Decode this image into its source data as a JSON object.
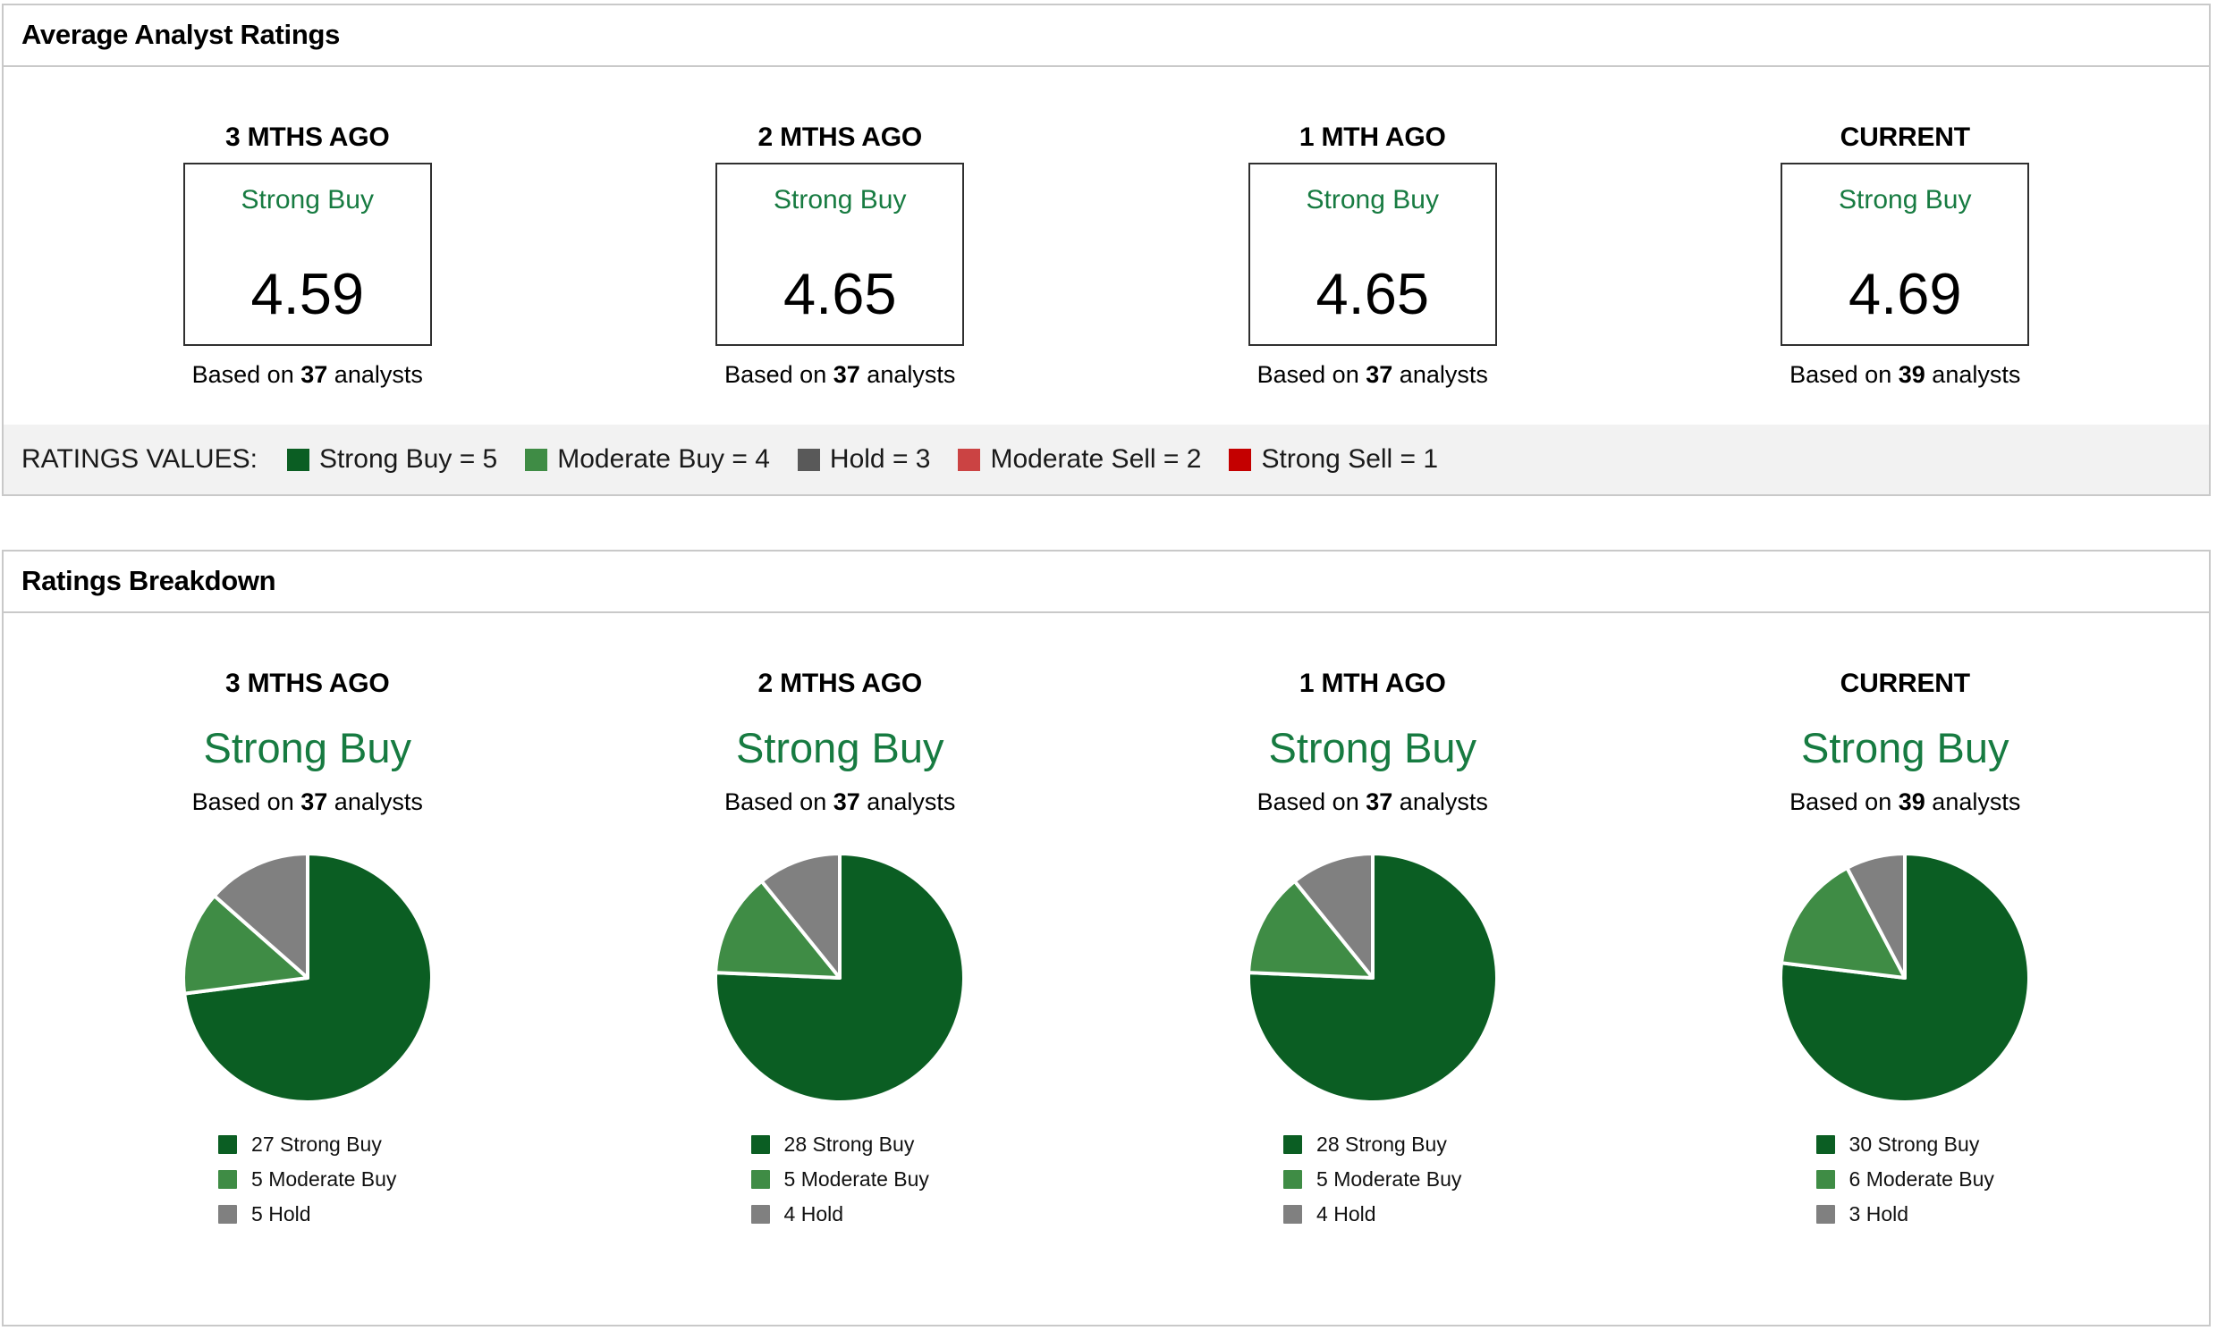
{
  "panel1": {
    "title": "Average Analyst Ratings",
    "columns": [
      {
        "period": "3 MTHS AGO",
        "rating": "Strong Buy",
        "score": "4.59",
        "based_prefix": "Based on",
        "analysts": "37",
        "based_suffix": "analysts"
      },
      {
        "period": "2 MTHS AGO",
        "rating": "Strong Buy",
        "score": "4.65",
        "based_prefix": "Based on",
        "analysts": "37",
        "based_suffix": "analysts"
      },
      {
        "period": "1 MTH AGO",
        "rating": "Strong Buy",
        "score": "4.65",
        "based_prefix": "Based on",
        "analysts": "37",
        "based_suffix": "analysts"
      },
      {
        "period": "CURRENT",
        "rating": "Strong Buy",
        "score": "4.69",
        "based_prefix": "Based on",
        "analysts": "39",
        "based_suffix": "analysts"
      }
    ],
    "legend": {
      "label": "RATINGS VALUES:",
      "items": [
        {
          "label": "Strong Buy = 5",
          "color": "#0b5e23"
        },
        {
          "label": "Moderate Buy = 4",
          "color": "#3f8c45"
        },
        {
          "label": "Hold = 3",
          "color": "#595959"
        },
        {
          "label": "Moderate Sell = 2",
          "color": "#cb4343"
        },
        {
          "label": "Strong Sell = 1",
          "color": "#c40000"
        }
      ]
    }
  },
  "panel2": {
    "title": "Ratings Breakdown",
    "columns": [
      {
        "period": "3 MTHS AGO",
        "rating": "Strong Buy",
        "based_prefix": "Based on",
        "analysts": "37",
        "based_suffix": "analysts",
        "legend": [
          {
            "count": "27",
            "label": "Strong Buy"
          },
          {
            "count": "5",
            "label": "Moderate Buy"
          },
          {
            "count": "5",
            "label": "Hold"
          }
        ]
      },
      {
        "period": "2 MTHS AGO",
        "rating": "Strong Buy",
        "based_prefix": "Based on",
        "analysts": "37",
        "based_suffix": "analysts",
        "legend": [
          {
            "count": "28",
            "label": "Strong Buy"
          },
          {
            "count": "5",
            "label": "Moderate Buy"
          },
          {
            "count": "4",
            "label": "Hold"
          }
        ]
      },
      {
        "period": "1 MTH AGO",
        "rating": "Strong Buy",
        "based_prefix": "Based on",
        "analysts": "37",
        "based_suffix": "analysts",
        "legend": [
          {
            "count": "28",
            "label": "Strong Buy"
          },
          {
            "count": "5",
            "label": "Moderate Buy"
          },
          {
            "count": "4",
            "label": "Hold"
          }
        ]
      },
      {
        "period": "CURRENT",
        "rating": "Strong Buy",
        "based_prefix": "Based on",
        "analysts": "39",
        "based_suffix": "analysts",
        "legend": [
          {
            "count": "30",
            "label": "Strong Buy"
          },
          {
            "count": "6",
            "label": "Moderate Buy"
          },
          {
            "count": "3",
            "label": "Hold"
          }
        ]
      }
    ]
  },
  "chart_data": [
    {
      "type": "pie",
      "title": "3 MTHS AGO",
      "labels": [
        "Strong Buy",
        "Moderate Buy",
        "Hold"
      ],
      "values": [
        27,
        5,
        5
      ],
      "colors": [
        "#0b5e23",
        "#3f8c45",
        "#808080"
      ],
      "total_analysts": 37,
      "average_rating": 4.59,
      "consensus": "Strong Buy"
    },
    {
      "type": "pie",
      "title": "2 MTHS AGO",
      "labels": [
        "Strong Buy",
        "Moderate Buy",
        "Hold"
      ],
      "values": [
        28,
        5,
        4
      ],
      "colors": [
        "#0b5e23",
        "#3f8c45",
        "#808080"
      ],
      "total_analysts": 37,
      "average_rating": 4.65,
      "consensus": "Strong Buy"
    },
    {
      "type": "pie",
      "title": "1 MTH AGO",
      "labels": [
        "Strong Buy",
        "Moderate Buy",
        "Hold"
      ],
      "values": [
        28,
        5,
        4
      ],
      "colors": [
        "#0b5e23",
        "#3f8c45",
        "#808080"
      ],
      "total_analysts": 37,
      "average_rating": 4.65,
      "consensus": "Strong Buy"
    },
    {
      "type": "pie",
      "title": "CURRENT",
      "labels": [
        "Strong Buy",
        "Moderate Buy",
        "Hold"
      ],
      "values": [
        30,
        6,
        3
      ],
      "colors": [
        "#0b5e23",
        "#3f8c45",
        "#808080"
      ],
      "total_analysts": 39,
      "average_rating": 4.69,
      "consensus": "Strong Buy"
    }
  ]
}
